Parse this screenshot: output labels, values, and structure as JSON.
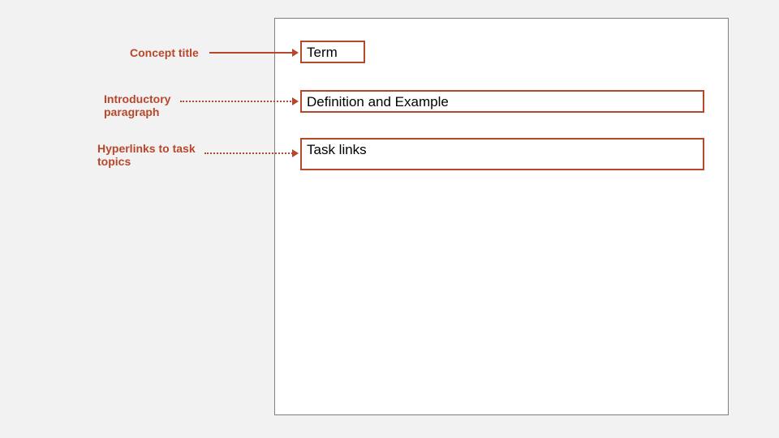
{
  "callouts": {
    "concept_title": "Concept title",
    "intro_paragraph": "Introductory paragraph",
    "hyperlinks": "Hyperlinks to task topics"
  },
  "boxes": {
    "term": "Term",
    "definition": "Definition and Example",
    "tasklinks": "Task links"
  }
}
